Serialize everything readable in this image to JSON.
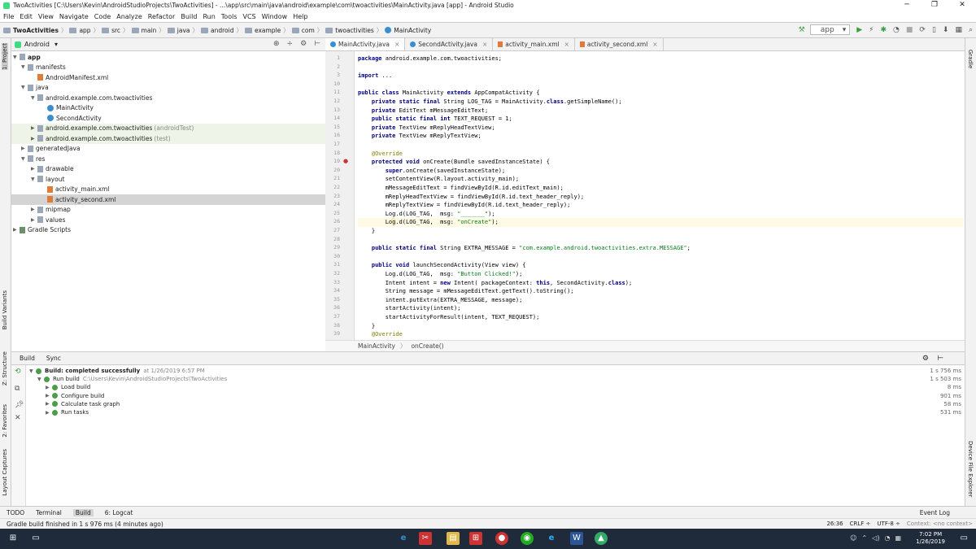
{
  "window": {
    "title": "TwoActivities [C:\\Users\\Kevin\\AndroidStudioProjects\\TwoActivities] - ...\\app\\src\\main\\java\\android\\example\\com\\twoactivities\\MainActivity.java [app] - Android Studio",
    "minimize": "─",
    "maximize": "❐",
    "close": "✕"
  },
  "menu": [
    "File",
    "Edit",
    "View",
    "Navigate",
    "Code",
    "Analyze",
    "Refactor",
    "Build",
    "Run",
    "Tools",
    "VCS",
    "Window",
    "Help"
  ],
  "breadcrumbs": [
    "TwoActivities",
    "app",
    "src",
    "main",
    "java",
    "android",
    "example",
    "com",
    "twoactivities",
    "MainActivity"
  ],
  "toolbar": {
    "run_config": "app",
    "config_arrow": "▾"
  },
  "sidebar": {
    "project_tab": "1: Project",
    "build_variants": "Build Variants",
    "structure": "Z: Structure",
    "favorites": "2: Favorites",
    "captures": "Layout Captures"
  },
  "rightbar": {
    "gradle": "Gradle",
    "device_explorer": "Device File Explorer"
  },
  "project": {
    "view": "Android",
    "view_arrow": "▾",
    "tree": [
      {
        "label": "app",
        "arrow": "▼"
      },
      {
        "label": "manifests",
        "arrow": "▼"
      },
      {
        "label": "AndroidManifest.xml",
        "arrow": ""
      },
      {
        "label": "java",
        "arrow": "▼"
      },
      {
        "label": "android.example.com.twoactivities",
        "arrow": "▼"
      },
      {
        "label": "MainActivity",
        "arrow": ""
      },
      {
        "label": "SecondActivity",
        "arrow": ""
      },
      {
        "label": "android.example.com.twoactivities",
        "arrow": "▶",
        "suffix": "(androidTest)"
      },
      {
        "label": "android.example.com.twoactivities",
        "arrow": "▶",
        "suffix": "(test)"
      },
      {
        "label": "generatedJava",
        "arrow": "▶"
      },
      {
        "label": "res",
        "arrow": "▼"
      },
      {
        "label": "drawable",
        "arrow": "▶"
      },
      {
        "label": "layout",
        "arrow": "▼"
      },
      {
        "label": "activity_main.xml",
        "arrow": ""
      },
      {
        "label": "activity_second.xml",
        "arrow": ""
      },
      {
        "label": "mipmap",
        "arrow": "▶"
      },
      {
        "label": "values",
        "arrow": "▶"
      },
      {
        "label": "Gradle Scripts",
        "arrow": "▶"
      }
    ]
  },
  "editor": {
    "tabs": [
      "MainActivity.java",
      "SecondActivity.java",
      "activity_main.xml",
      "activity_second.xml"
    ],
    "tab_close": "×",
    "line_numbers": [
      "1",
      "2",
      "3",
      "10",
      "11",
      "12",
      "13",
      "14",
      "15",
      "16",
      "17",
      "18",
      "19",
      "20",
      "21",
      "22",
      "23",
      "24",
      "25",
      "26",
      "27",
      "28",
      "29",
      "30",
      "31",
      "32",
      "33",
      "34",
      "35",
      "36",
      "37",
      "38",
      "39"
    ],
    "lines": [
      "package android.example.com.twoactivities;",
      "",
      "import ...",
      "",
      "public class MainActivity extends AppCompatActivity {",
      "    private static final String LOG_TAG = MainActivity.class.getSimpleName();",
      "    private EditText mMessageEditText;",
      "    public static final int TEXT_REQUEST = 1;",
      "    private TextView mReplyHeadTextView;",
      "    private TextView mReplyTextView;",
      "",
      "    @Override",
      "    protected void onCreate(Bundle savedInstanceState) {",
      "        super.onCreate(savedInstanceState);",
      "        setContentView(R.layout.activity_main);",
      "        mMessageEditText = findViewById(R.id.editText_main);",
      "        mReplyHeadTextView = findViewById(R.id.text_header_reply);",
      "        mReplyTextView = findViewById(R.id.text_header_reply);",
      "        Log.d(LOG_TAG,  msg: \"_______\");",
      "        Log.d(LOG_TAG,  msg: \"onCreate\");",
      "    }",
      "",
      "    public static final String EXTRA_MESSAGE = \"com.example.android.twoactivities.extra.MESSAGE\";",
      "",
      "    public void launchSecondActivity(View view) {",
      "        Log.d(LOG_TAG,  msg: \"Button Clicked!\");",
      "        Intent intent = new Intent( packageContext: this, SecondActivity.class);",
      "        String message = mMessageEditText.getText().toString();",
      "        intent.putExtra(EXTRA_MESSAGE, message);",
      "        startActivity(intent);",
      "        startActivityForResult(intent, TEXT_REQUEST);",
      "    }",
      "    @Override"
    ],
    "current_line_index": 19,
    "crumbs": [
      "MainActivity",
      "onCreate()"
    ]
  },
  "build": {
    "tabs": [
      "Build",
      "Sync"
    ],
    "entries": [
      {
        "text": "Build: completed successfully",
        "meta": "at 1/26/2019 6:57 PM",
        "time": "1 s 756 ms",
        "level": 0
      },
      {
        "text": "Run build",
        "meta": "C:\\Users\\Kevin\\AndroidStudioProjects\\TwoActivities",
        "time": "1 s 503 ms",
        "level": 1
      },
      {
        "text": "Load build",
        "meta": "",
        "time": "8 ms",
        "level": 2
      },
      {
        "text": "Configure build",
        "meta": "",
        "time": "901 ms",
        "level": 2
      },
      {
        "text": "Calculate task graph",
        "meta": "",
        "time": "58 ms",
        "level": 2
      },
      {
        "text": "Run tasks",
        "meta": "",
        "time": "531 ms",
        "level": 2
      }
    ]
  },
  "bottom_tabs": [
    "TODO",
    "Terminal",
    "Build",
    "6: Logcat"
  ],
  "event_log": "Event Log",
  "status": {
    "message": "Gradle build finished in 1 s 976 ms (4 minutes ago)",
    "position": "26:36",
    "line_sep": "CRLF ÷",
    "encoding": "UTF-8 ÷",
    "context": "Context: <no context>"
  },
  "taskbar": {
    "time": "7:02 PM",
    "date": "1/26/2019"
  }
}
